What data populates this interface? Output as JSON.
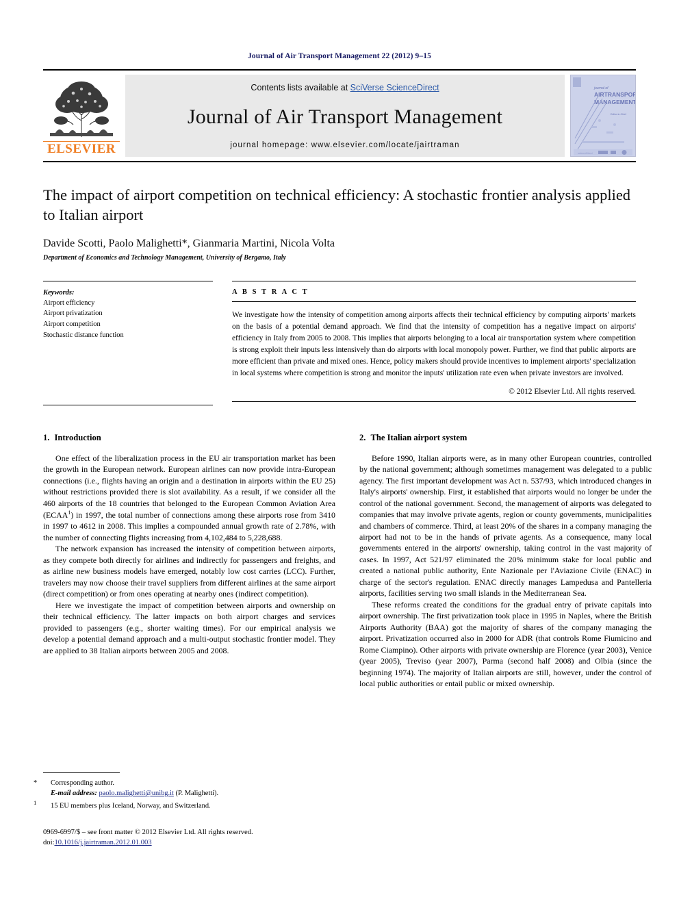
{
  "running_head": "Journal of Air Transport Management 22 (2012) 9–15",
  "masthead": {
    "publisher_logo_name": "elsevier-tree-logo",
    "publisher_name": "ELSEVIER",
    "contents_prefix": "Contents lists available at ",
    "contents_link": "SciVerse ScienceDirect",
    "journal_name": "Journal of Air Transport Management",
    "homepage_label": "journal homepage: www.elsevier.com/locate/jairtraman",
    "cover": {
      "line1": "journal of",
      "line2": "AIR TRANSPORT",
      "line3": "MANAGEMENT"
    }
  },
  "article": {
    "title": "The impact of airport competition on technical efficiency: A stochastic frontier analysis applied to Italian airport",
    "authors": "Davide Scotti, Paolo Malighetti*, Gianmaria Martini, Nicola Volta",
    "affiliation": "Department of Economics and Technology Management, University of Bergamo, Italy"
  },
  "keywords": {
    "heading": "Keywords:",
    "items": [
      "Airport efficiency",
      "Airport privatization",
      "Airport competition",
      "Stochastic distance function"
    ]
  },
  "abstract": {
    "heading": "A B S T R A C T",
    "text": "We investigate how the intensity of competition among airports affects their technical efficiency by computing airports' markets on the basis of a potential demand approach. We find that the intensity of competition has a negative impact on airports' efficiency in Italy from 2005 to 2008. This implies that airports belonging to a local air transportation system where competition is strong exploit their inputs less intensively than do airports with local monopoly power. Further, we find that public airports are more efficient than private and mixed ones. Hence, policy makers should provide incentives to implement airports' specialization in local systems where competition is strong and monitor the inputs' utilization rate even when private investors are involved.",
    "rights": "© 2012 Elsevier Ltd. All rights reserved."
  },
  "sections": [
    {
      "number": "1.",
      "title": "Introduction",
      "paragraphs": [
        "One effect of the liberalization process in the EU air transportation market has been the growth in the European network. European airlines can now provide intra-European connections (i.e., flights having an origin and a destination in airports within the EU 25) without restrictions provided there is slot availability. As a result, if we consider all the 460 airports of the 18 countries that belonged to the European Common Aviation Area (ECAA",
        "The network expansion has increased the intensity of competition between airports, as they compete both directly for airlines and indirectly for passengers and freights, and as airline new business models have emerged, notably low cost carries (LCC). Further, travelers may now choose their travel suppliers from different airlines at the same airport (direct competition) or from ones operating at nearby ones (indirect competition).",
        "Here we investigate the impact of competition between airports and ownership on their technical efficiency. The latter impacts on both airport charges and services provided to passengers (e.g., shorter waiting times). For our empirical analysis we develop a potential demand approach and a multi-output stochastic frontier model. They are applied to 38 Italian airports between 2005 and 2008."
      ],
      "para1_footnote_marker": "1",
      "para1_tail": ") in 1997, the total number of connections among these airports rose from 3410 in 1997 to 4612 in 2008. This implies a compounded annual growth rate of 2.78%, with the number of connecting flights increasing from 4,102,484 to 5,228,688."
    },
    {
      "number": "2.",
      "title": "The Italian airport system",
      "paragraphs": [
        "Before 1990, Italian airports were, as in many other European countries, controlled by the national government; although sometimes management was delegated to a public agency. The first important development was Act n. 537/93, which introduced changes in Italy's airports' ownership. First, it established that airports would no longer be under the control of the national government. Second, the management of airports was delegated to companies that may involve private agents, region or county governments, municipalities and chambers of commerce. Third, at least 20% of the shares in a company managing the airport had not to be in the hands of private agents. As a consequence, many local governments entered in the airports' ownership, taking control in the vast majority of cases. In 1997, Act 521/97 eliminated the 20% minimum stake for local public and created a national public authority, Ente Nazionale per l'Aviazione Civile (ENAC) in charge of the sector's regulation. ENAC directly manages Lampedusa and Pantelleria airports, facilities serving two small islands in the Mediterranean Sea.",
        "These reforms created the conditions for the gradual entry of private capitals into airport ownership. The first privatization took place in 1995 in Naples, where the British Airports Authority (BAA) got the majority of shares of the company managing the airport. Privatization occurred also in 2000 for ADR (that controls Rome Fiumicino and Rome Ciampino). Other airports with private ownership are Florence (year 2003), Venice (year 2005), Treviso (year 2007), Parma (second half 2008) and Olbia (since the beginning 1974). The majority of Italian airports are still, however, under the control of local public authorities or entail public or mixed ownership."
      ]
    }
  ],
  "footnotes": {
    "corresponding_marker": "*",
    "corresponding_text": "Corresponding author.",
    "email_label": "E-mail address:",
    "email_value": "paolo.malighetti@unibg.it",
    "email_attribution": "(P. Malighetti).",
    "note1_marker": "1",
    "note1_text": "15 EU members plus Iceland, Norway, and Switzerland."
  },
  "imprint": {
    "line1": "0969-6997/$ – see front matter © 2012 Elsevier Ltd. All rights reserved.",
    "doi_label": "doi:",
    "doi_value": "10.1016/j.jairtraman.2012.01.003"
  },
  "colors": {
    "running_head": "#181b63",
    "link_blue": "#2a58a8",
    "elsevier_orange": "#ef7d22",
    "band_gray": "#e9e9e9",
    "cover_blue": "#ccd2ea"
  }
}
